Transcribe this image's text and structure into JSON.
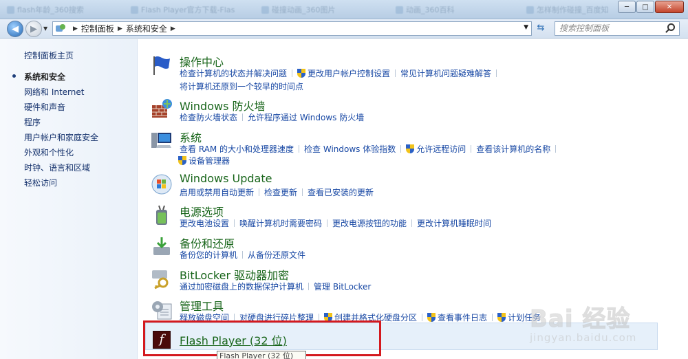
{
  "titlebar": {
    "ghost_tabs": [
      "flash年龄_360搜索",
      "Flash Player官方下载-Flas",
      "碰撞动画_360图片",
      "动画_360百科",
      "怎样制作碰撞_百度知"
    ]
  },
  "window_buttons": {
    "minimize": "─",
    "maximize": "□",
    "close": "✕"
  },
  "address": {
    "crumbs": [
      "控制面板",
      "系统和安全"
    ],
    "search_placeholder": "搜索控制面板"
  },
  "sidebar": {
    "home": "控制面板主页",
    "items": [
      {
        "label": "系统和安全",
        "current": true
      },
      {
        "label": "网络和 Internet"
      },
      {
        "label": "硬件和声音"
      },
      {
        "label": "程序"
      },
      {
        "label": "用户帐户和家庭安全"
      },
      {
        "label": "外观和个性化"
      },
      {
        "label": "时钟、语言和区域"
      },
      {
        "label": "轻松访问"
      }
    ]
  },
  "categories": [
    {
      "title": "操作中心",
      "icon": "flag-icon",
      "lines": [
        [
          "检查计算机的状态并解决问题",
          "更改用户帐户控制设置",
          "常见计算机问题疑难解答"
        ],
        [
          "将计算机还原到一个较早的时间点"
        ]
      ]
    },
    {
      "title": "Windows 防火墙",
      "icon": "firewall-icon",
      "lines": [
        [
          "检查防火墙状态",
          "允许程序通过 Windows 防火墙"
        ]
      ]
    },
    {
      "title": "系统",
      "icon": "computer-icon",
      "lines": [
        [
          "查看 RAM 的大小和处理器速度",
          "检查 Windows 体验指数",
          "允许远程访问",
          "查看该计算机的名称"
        ],
        [
          "设备管理器"
        ]
      ]
    },
    {
      "title": "Windows Update",
      "icon": "windows-update-icon",
      "lines": [
        [
          "启用或禁用自动更新",
          "检查更新",
          "查看已安装的更新"
        ]
      ]
    },
    {
      "title": "电源选项",
      "icon": "power-icon",
      "lines": [
        [
          "更改电池设置",
          "唤醒计算机时需要密码",
          "更改电源按钮的功能",
          "更改计算机睡眠时间"
        ]
      ]
    },
    {
      "title": "备份和还原",
      "icon": "backup-icon",
      "lines": [
        [
          "备份您的计算机",
          "从备份还原文件"
        ]
      ]
    },
    {
      "title": "BitLocker 驱动器加密",
      "icon": "bitlocker-icon",
      "lines": [
        [
          "通过加密磁盘上的数据保护计算机",
          "管理 BitLocker"
        ]
      ]
    },
    {
      "title": "管理工具",
      "icon": "admin-tools-icon",
      "lines": [
        [
          "释放磁盘空间",
          "对硬盘进行碎片整理",
          "创建并格式化硬盘分区",
          "查看事件日志",
          "计划任务"
        ]
      ]
    }
  ],
  "flash": {
    "title": "Flash Player (32 位)",
    "icon_glyph": "f",
    "tooltip": "Flash Player (32 位)"
  },
  "watermark": {
    "logo": "Bai 经验",
    "url": "jingyan.baidu.com"
  },
  "colors": {
    "title_green": "#18651a",
    "link_blue": "#1848a4",
    "highlight_red": "#d4191e"
  }
}
